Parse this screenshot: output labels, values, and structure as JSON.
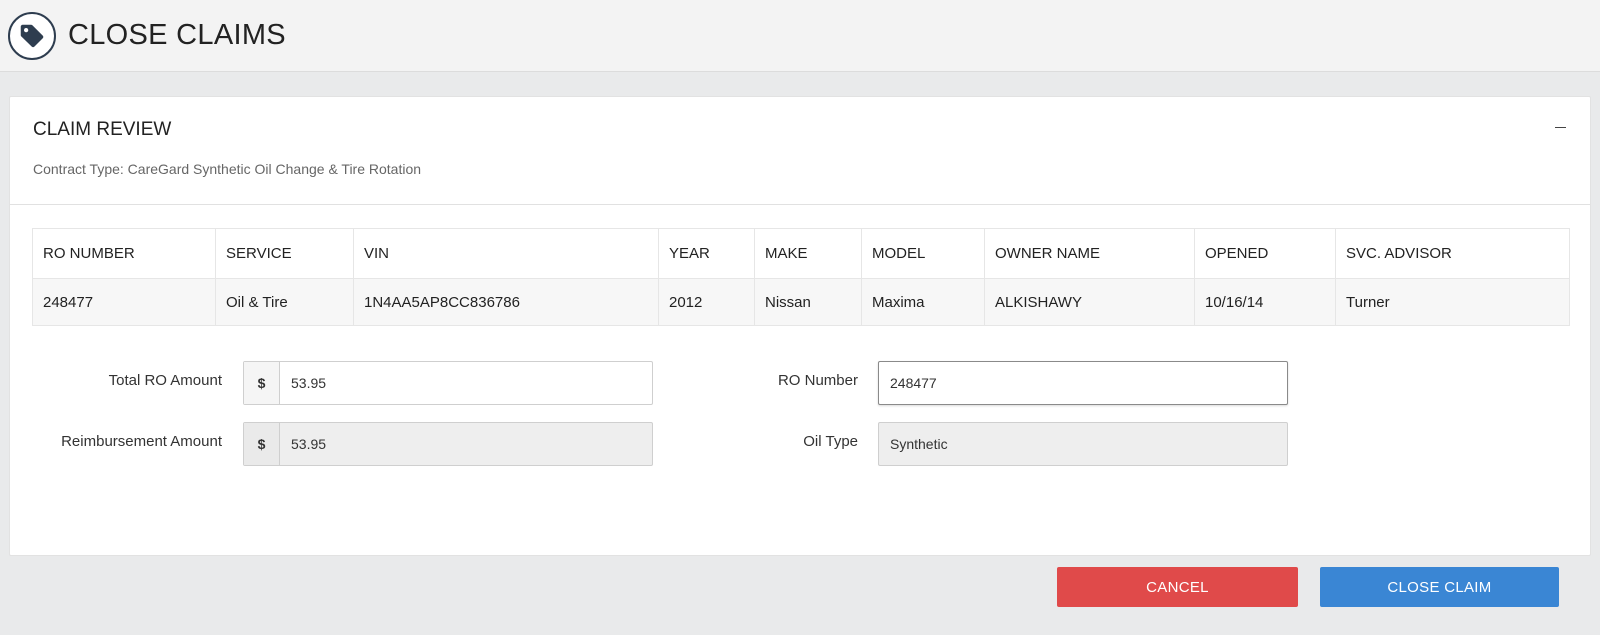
{
  "header": {
    "title": "CLOSE CLAIMS",
    "icon": "tag-icon"
  },
  "panel": {
    "title": "CLAIM REVIEW",
    "subtitle": "Contract Type: CareGard Synthetic Oil Change & Tire Rotation",
    "collapse_icon": "minus-icon"
  },
  "table": {
    "columns": [
      "RO NUMBER",
      "SERVICE",
      "VIN",
      "YEAR",
      "MAKE",
      "MODEL",
      "OWNER NAME",
      "OPENED",
      "SVC. ADVISOR"
    ],
    "rows": [
      [
        "248477",
        "Oil & Tire",
        "1N4AA5AP8CC836786",
        "2012",
        "Nissan",
        "Maxima",
        "ALKISHAWY",
        "10/16/14",
        "Turner"
      ]
    ]
  },
  "form": {
    "total_ro_label": "Total RO Amount",
    "total_ro_currency": "$",
    "total_ro_value": "53.95",
    "reimbursement_label": "Reimbursement Amount",
    "reimbursement_currency": "$",
    "reimbursement_value": "53.95",
    "ro_number_label": "RO Number",
    "ro_number_value": "248477",
    "oil_type_label": "Oil Type",
    "oil_type_value": "Synthetic"
  },
  "buttons": {
    "cancel": "CANCEL",
    "close_claim": "CLOSE CLAIM"
  },
  "colors": {
    "cancel": "#e04a4a",
    "close_claim": "#3a86d4",
    "icon_dark": "#2e3d4f"
  }
}
